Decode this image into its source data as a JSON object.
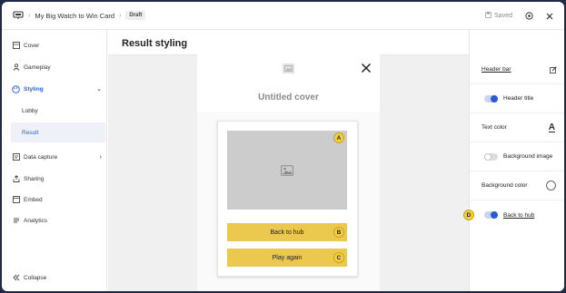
{
  "header": {
    "breadcrumb": "My Big Watch to Win Card",
    "status_badge": "Draft",
    "saved_label": "Saved"
  },
  "sidebar": {
    "items": [
      {
        "label": "Cover",
        "icon": "cover-icon"
      },
      {
        "label": "Gameplay",
        "icon": "gameplay-icon"
      },
      {
        "label": "Styling",
        "icon": "palette-icon"
      },
      {
        "label": "Data capture",
        "icon": "data-capture-icon"
      },
      {
        "label": "Sharing",
        "icon": "share-icon"
      },
      {
        "label": "Embed",
        "icon": "embed-icon"
      },
      {
        "label": "Analytics",
        "icon": "analytics-icon"
      }
    ],
    "sub_items": [
      {
        "label": "Lobby"
      },
      {
        "label": "Result"
      }
    ],
    "collapse_label": "Collapse"
  },
  "main": {
    "title": "Result styling",
    "preview": {
      "cover_title": "Untitled cover",
      "back_button": "Back to hub",
      "play_button": "Play again",
      "markers": [
        "A",
        "B",
        "C",
        "D"
      ]
    }
  },
  "right_panel": {
    "header_bar": "Header bar",
    "header_title": "Header title",
    "text_color": "Text color",
    "background_image": "Background image",
    "background_color": "Background color",
    "back_to_hub": "Back to hub",
    "toggles": {
      "header_title": true,
      "background_image": false,
      "back_to_hub": true
    }
  },
  "colors": {
    "accent": "#2a5bd7",
    "button_yellow": "#ebc94f",
    "marker_yellow": "#f4d03f",
    "image_placeholder": "#cccccc"
  }
}
